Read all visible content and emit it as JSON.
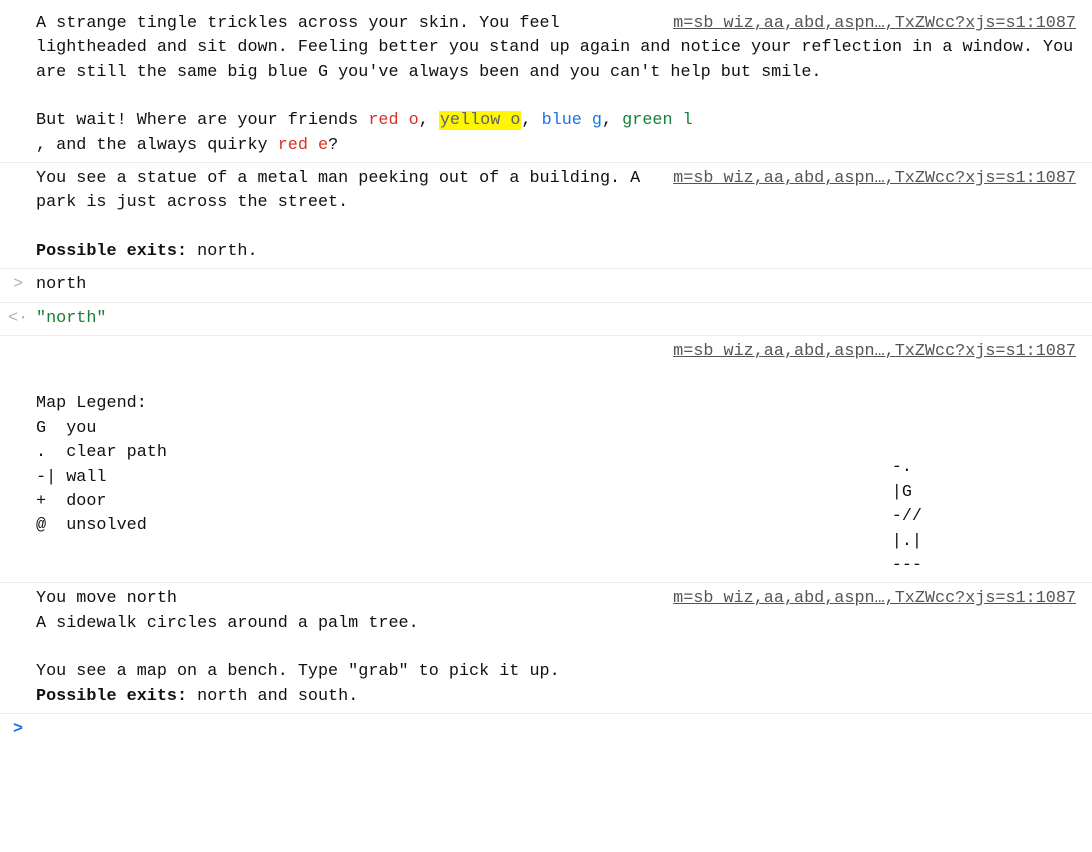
{
  "link_text": "m=sb_wiz,aa,abd,aspn…,TxZWcc?xjs=s1:1087",
  "block1": {
    "p1_a": "A strange tingle trickles across",
    "p1_b": "your skin.  You feel lightheaded and sit down.  Feeling better you stand up again and notice your reflection in a window.  You are still the same big blue G you've always been and you can't help but smile.",
    "p2_lead": "But wait!  Where are your friends ",
    "friends": [
      {
        "text": "red o",
        "cls": "red"
      },
      {
        "text": "yellow o",
        "cls": "yellow-hl"
      },
      {
        "text": "blue g",
        "cls": "blue"
      },
      {
        "text": "green l",
        "cls": "green"
      }
    ],
    "p2_sep": ", ",
    "p2_tail_a": ", and the always quirky ",
    "p2_last_friend": {
      "text": "red e",
      "cls": "red"
    },
    "p2_tail_b": "?"
  },
  "block2": {
    "p1_a": "You see a statue of a metal man",
    "p1_b": "peeking out of a building.  A park is just across the street.",
    "exits_label": "Possible exits:",
    "exits_value": " north."
  },
  "input1": {
    "gutter": ">",
    "text": "north"
  },
  "echo1": {
    "gutter": "<·",
    "text": "\"north\""
  },
  "block3": {
    "legend_title": "Map Legend:",
    "legend": [
      {
        "sym": "G",
        "desc": "you"
      },
      {
        "sym": ".",
        "desc": "clear path"
      },
      {
        "sym": "-|",
        "desc": "wall"
      },
      {
        "sym": "+",
        "desc": "door"
      },
      {
        "sym": "@",
        "desc": "unsolved"
      }
    ],
    "ascii_map": "-.\n|G\n-//\n|.|\n---"
  },
  "block4": {
    "p1_a": "You move north",
    "p2": "A sidewalk circles around a palm tree.",
    "p3": "You see a map on a bench.  Type \"grab\" to pick it up.",
    "exits_label": "Possible exits:",
    "exits_value": " north and south."
  },
  "prompt": {
    "gutter": ">"
  }
}
